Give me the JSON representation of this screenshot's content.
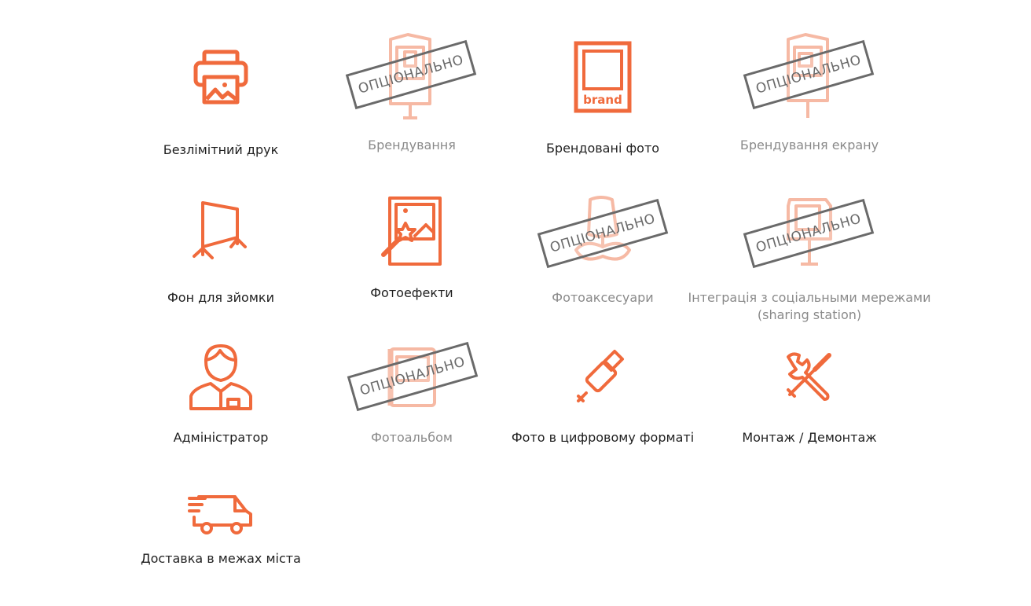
{
  "accent_color": "#f06a3c",
  "faded_color": "#f6b9a4",
  "stamp_text": "ОПЦІОНАЛЬНО",
  "features": [
    {
      "label": "Безлімітний друк",
      "icon": "printer-icon",
      "optional": false
    },
    {
      "label": "Брендування",
      "icon": "photobooth-branding-icon",
      "optional": true
    },
    {
      "label": "Брендовані фото",
      "icon": "branded-photo-icon",
      "optional": false,
      "icon_text": "brand"
    },
    {
      "label": "Брендування екрану",
      "icon": "screen-branding-icon",
      "optional": true
    },
    {
      "label": "Фон для зйомки",
      "icon": "backdrop-stand-icon",
      "optional": false
    },
    {
      "label": "Фотоефекти",
      "icon": "magic-wand-photo-icon",
      "optional": false
    },
    {
      "label": "Фотоаксесуари",
      "icon": "photo-props-mustache-icon",
      "optional": true
    },
    {
      "label": "Інтеграція з соціальными мережами",
      "label2": "(sharing station)",
      "icon": "sharing-station-icon",
      "optional": true
    },
    {
      "label": "Адміністратор",
      "icon": "administrator-icon",
      "optional": false
    },
    {
      "label": "Фотоальбом",
      "icon": "photo-album-icon",
      "optional": true
    },
    {
      "label": "Фото в цифровому форматі",
      "icon": "usb-drive-icon",
      "optional": false
    },
    {
      "label": "Монтаж / Демонтаж",
      "icon": "tools-icon",
      "optional": false
    },
    {
      "label": "Доставка в межах міста",
      "icon": "delivery-van-icon",
      "optional": false
    }
  ]
}
